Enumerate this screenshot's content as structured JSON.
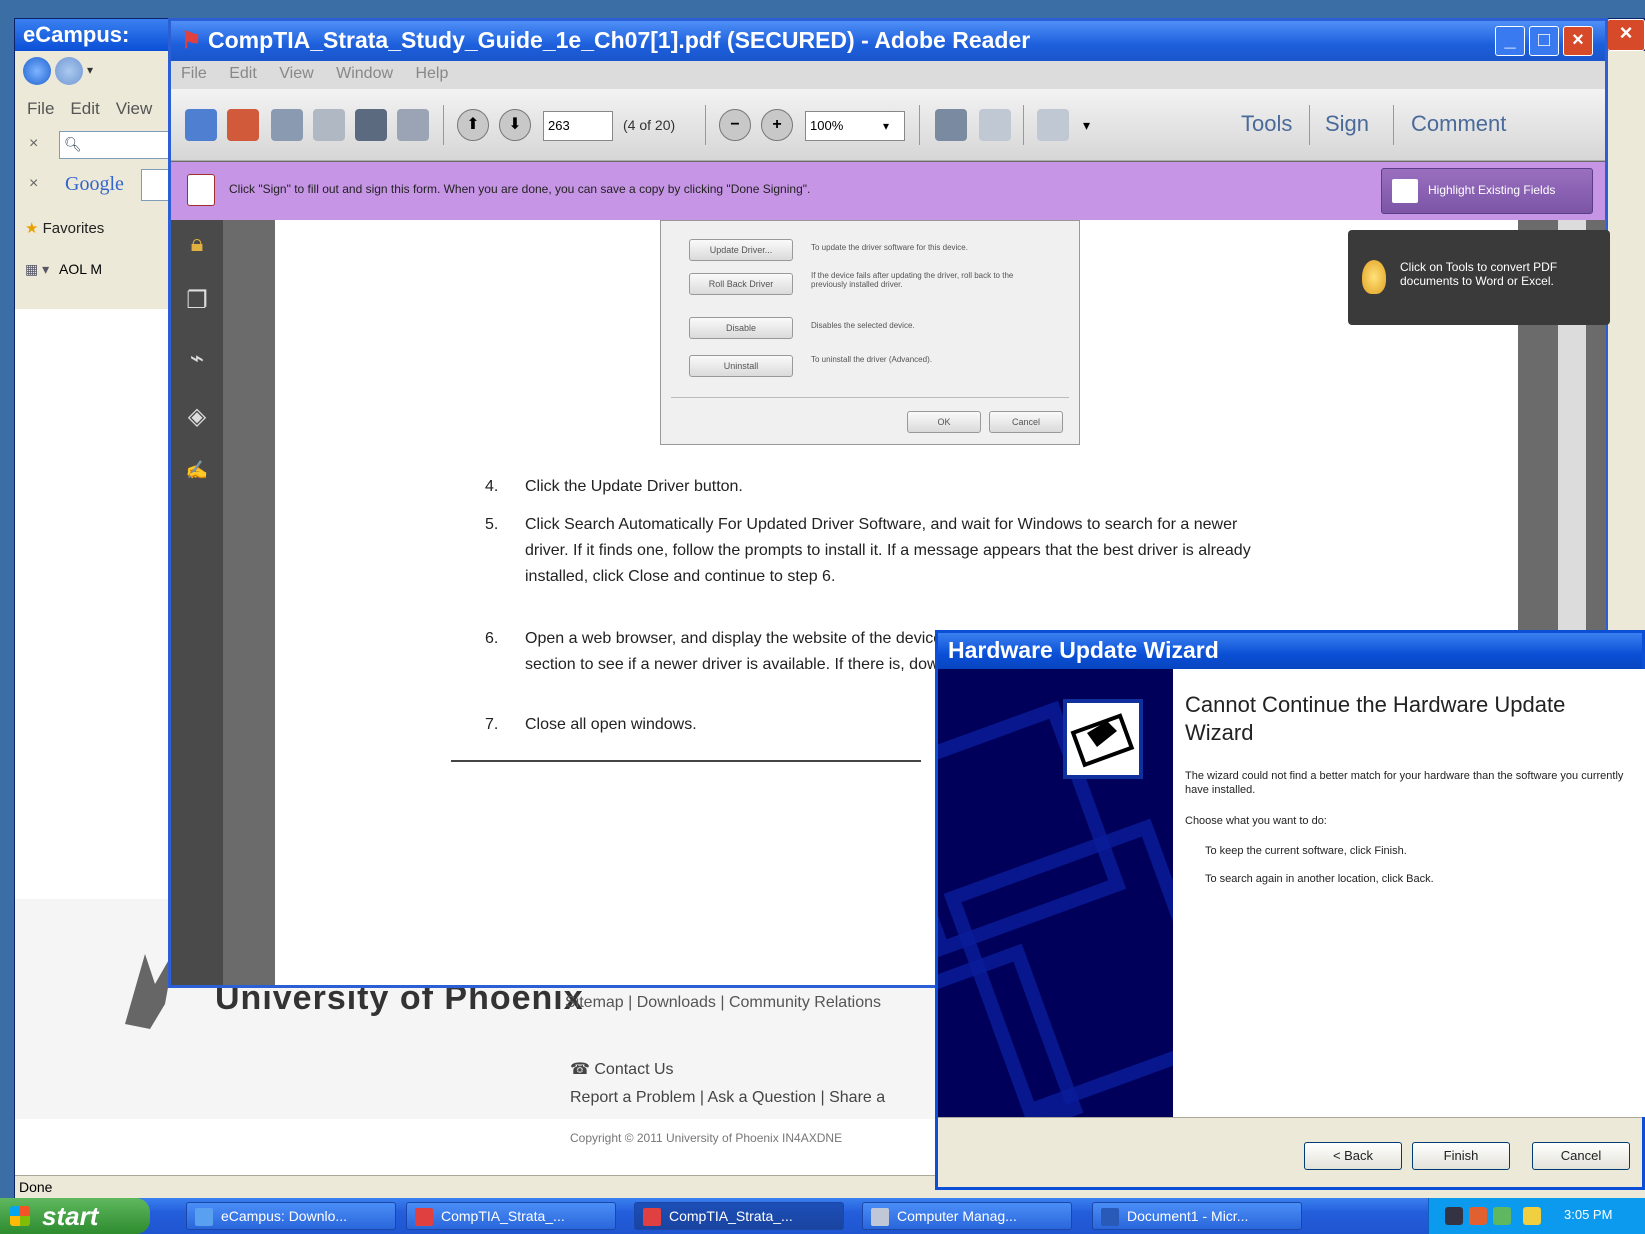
{
  "ie": {
    "title": "eCampus:",
    "menu": [
      "File",
      "Edit",
      "View"
    ],
    "search_placeholder": "",
    "google_label": "Google",
    "favorites_label": "Favorites",
    "tab_label": "AOL M",
    "status": "Done",
    "footer": {
      "university": "University of Phoenix",
      "links": "Sitemap | Downloads | Community Relations",
      "contact": "Contact Us",
      "report": "Report a Problem | Ask a Question | Share a",
      "copyright": "Copyright © 2011 University of Phoenix IN4AXDNE"
    }
  },
  "reader": {
    "title": "CompTIA_Strata_Study_Guide_1e_Ch07[1].pdf (SECURED) - Adobe Reader",
    "menu": [
      "File",
      "Edit",
      "View",
      "Window",
      "Help"
    ],
    "page_field": "263",
    "page_count": "(4 of 20)",
    "zoom": "100%",
    "tools_label": "Tools",
    "sign_label": "Sign",
    "comment_label": "Comment",
    "info_text": "Click \"Sign\" to fill out and sign this form. When you are done, you can save a copy by clicking \"Done Signing\".",
    "highlight_label": "Highlight Existing Fields",
    "tip": "Click on Tools to convert PDF documents to Word or Excel.",
    "dialog": {
      "buttons": [
        "Update Driver...",
        "Roll Back Driver",
        "Disable",
        "Uninstall"
      ],
      "descriptions": [
        "To update the driver software for this device.",
        "If the device fails after updating the driver, roll back to the previously installed driver.",
        "Disables the selected device.",
        "To uninstall the driver (Advanced)."
      ],
      "ok": "OK",
      "cancel": "Cancel"
    },
    "steps": [
      {
        "num": "4.",
        "text": "Click the Update Driver button."
      },
      {
        "num": "5.",
        "text": "Click Search Automatically For Updated Driver Software, and wait for Windows to search for a newer driver. If it finds one, follow the prompts to install it. If a message appears that the best driver is already installed, click Close and continue to step 6."
      },
      {
        "num": "6.",
        "text": "Open a web browser, and display the website of the device manufacturer. Search through the Support section to see if a newer driver is available. If there is, download and install it."
      },
      {
        "num": "7.",
        "text": "Close all open windows."
      }
    ]
  },
  "wizard": {
    "title": "Hardware Update Wizard",
    "heading": "Cannot Continue the Hardware Update Wizard",
    "body1": "The wizard could not find a better match for your hardware than the software you currently have installed.",
    "body2": "Choose what you want to do:",
    "body3": "To keep the current software, click Finish.",
    "body4": "To search again in another location, click Back.",
    "back": "< Back",
    "finish": "Finish",
    "cancel": "Cancel"
  },
  "taskbar": {
    "start": "start",
    "items": [
      "eCampus: Downlo...",
      "CompTIA_Strata_...",
      "CompTIA_Strata_...",
      "Computer Manag...",
      "Document1 - Micr..."
    ],
    "clock": "3:05 PM"
  },
  "colors": {
    "xp_blue": "#0a4fd6",
    "infobar_purple": "#c795e6",
    "wizard_panel": "#00005a",
    "start_green": "#2e8b2e"
  }
}
